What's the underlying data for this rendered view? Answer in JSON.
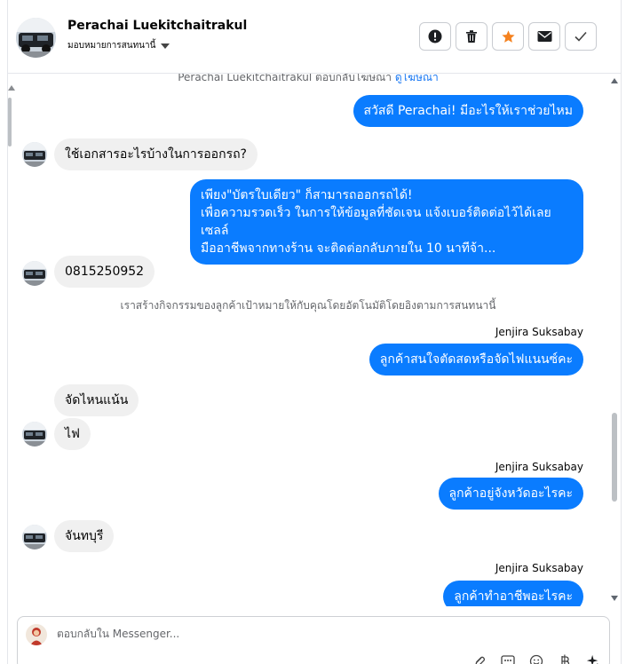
{
  "header": {
    "contact_name": "Perachai Luekitchaitrakul",
    "assign_label": "มอบหมายการสนทนานี้"
  },
  "conversation": {
    "top_note_prefix": "Perachai Luekitchaitrakul ตอบกลับโฆษณา",
    "top_note_link": "ดูโฆษณา",
    "auto_note": "เราสร้างกิจกรรมของลูกค้าเป้าหมายให้กับคุณโดยอัตโนมัติโดยอิงตามการสนทนานี้",
    "messages": [
      {
        "direction": "out",
        "text": "สวัสดี Perachai! มีอะไรให้เราช่วยไหม"
      },
      {
        "direction": "in",
        "text": "ใช้เอกสารอะไรบ้างในการออกรถ?"
      },
      {
        "direction": "out",
        "text": "เพียง\"บัตรใบเดียว\" ก็สามารถออกรถได้!\nเพื่อความรวดเร็ว ในการให้ข้อมูลที่ชัดเจน แจ้งเบอร์ติดต่อไว้ได้เลย เซลล์\nมืออาชีพจากทางร้าน จะติดต่อกลับภายใน 10 นาทีจ้า..."
      },
      {
        "direction": "in",
        "text": "0815250952"
      },
      {
        "direction": "out",
        "sender": "Jenjira Suksabay",
        "text": "ลูกค้าสนใจตัดสดหรือจัดไฟแนนซ์คะ"
      },
      {
        "direction": "in",
        "text": "จัดไหนแน้น"
      },
      {
        "direction": "in",
        "text": "ไฟ"
      },
      {
        "direction": "out",
        "sender": "Jenjira Suksabay",
        "text": "ลูกค้าอยู่จังหวัดอะไรคะ"
      },
      {
        "direction": "in",
        "text": "จันทบุรี"
      },
      {
        "direction": "out",
        "sender": "Jenjira Suksabay",
        "text": "ลูกค้าทำอาชีพอะไรคะ"
      }
    ]
  },
  "composer": {
    "placeholder": "ตอบกลับใน Messenger..."
  },
  "icons": {
    "header_actions": [
      "alert-icon",
      "trash-icon",
      "star-icon",
      "mail-icon",
      "check-icon"
    ],
    "composer_tools": [
      "attach-icon",
      "saved-reply-icon",
      "emoji-icon",
      "currency-icon",
      "sparkle-icon"
    ]
  },
  "colors": {
    "outgoing_bubble": "#0a7cff",
    "incoming_bubble": "#f0f0f0",
    "star": "#f5821f",
    "link": "#1877f2"
  }
}
